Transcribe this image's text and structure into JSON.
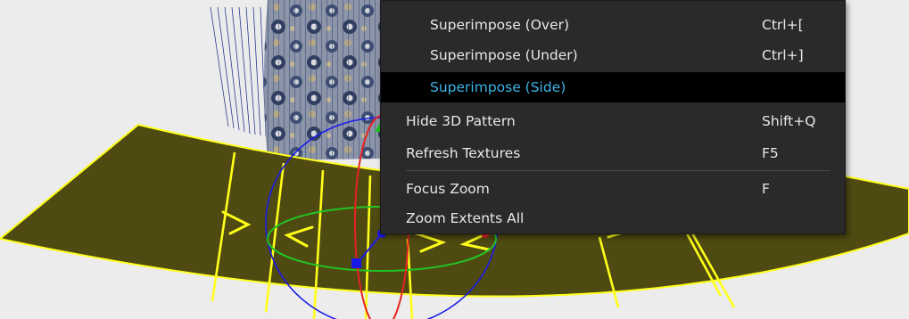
{
  "colors": {
    "fabric": "#4f4a12",
    "pattern_lines": "#ffff1a",
    "menu_background": "#2a2a2a",
    "menu_highlight": "#000000",
    "menu_highlight_text": "#3fb4e6",
    "gizmo_x": "#e62222",
    "gizmo_y": "#22c422",
    "gizmo_z": "#1a1ae8"
  },
  "context_menu": {
    "items": [
      {
        "label": "Superimpose (Over)",
        "shortcut": "Ctrl+["
      },
      {
        "label": "Superimpose (Under)",
        "shortcut": "Ctrl+]"
      },
      {
        "label": "Superimpose (Side)",
        "shortcut": ""
      },
      {
        "label": "Hide 3D Pattern",
        "shortcut": "Shift+Q"
      },
      {
        "label": "Refresh Textures",
        "shortcut": "F5"
      },
      {
        "label": "Focus Zoom",
        "shortcut": "F"
      },
      {
        "label": "Zoom Extents All",
        "shortcut": ""
      }
    ]
  }
}
